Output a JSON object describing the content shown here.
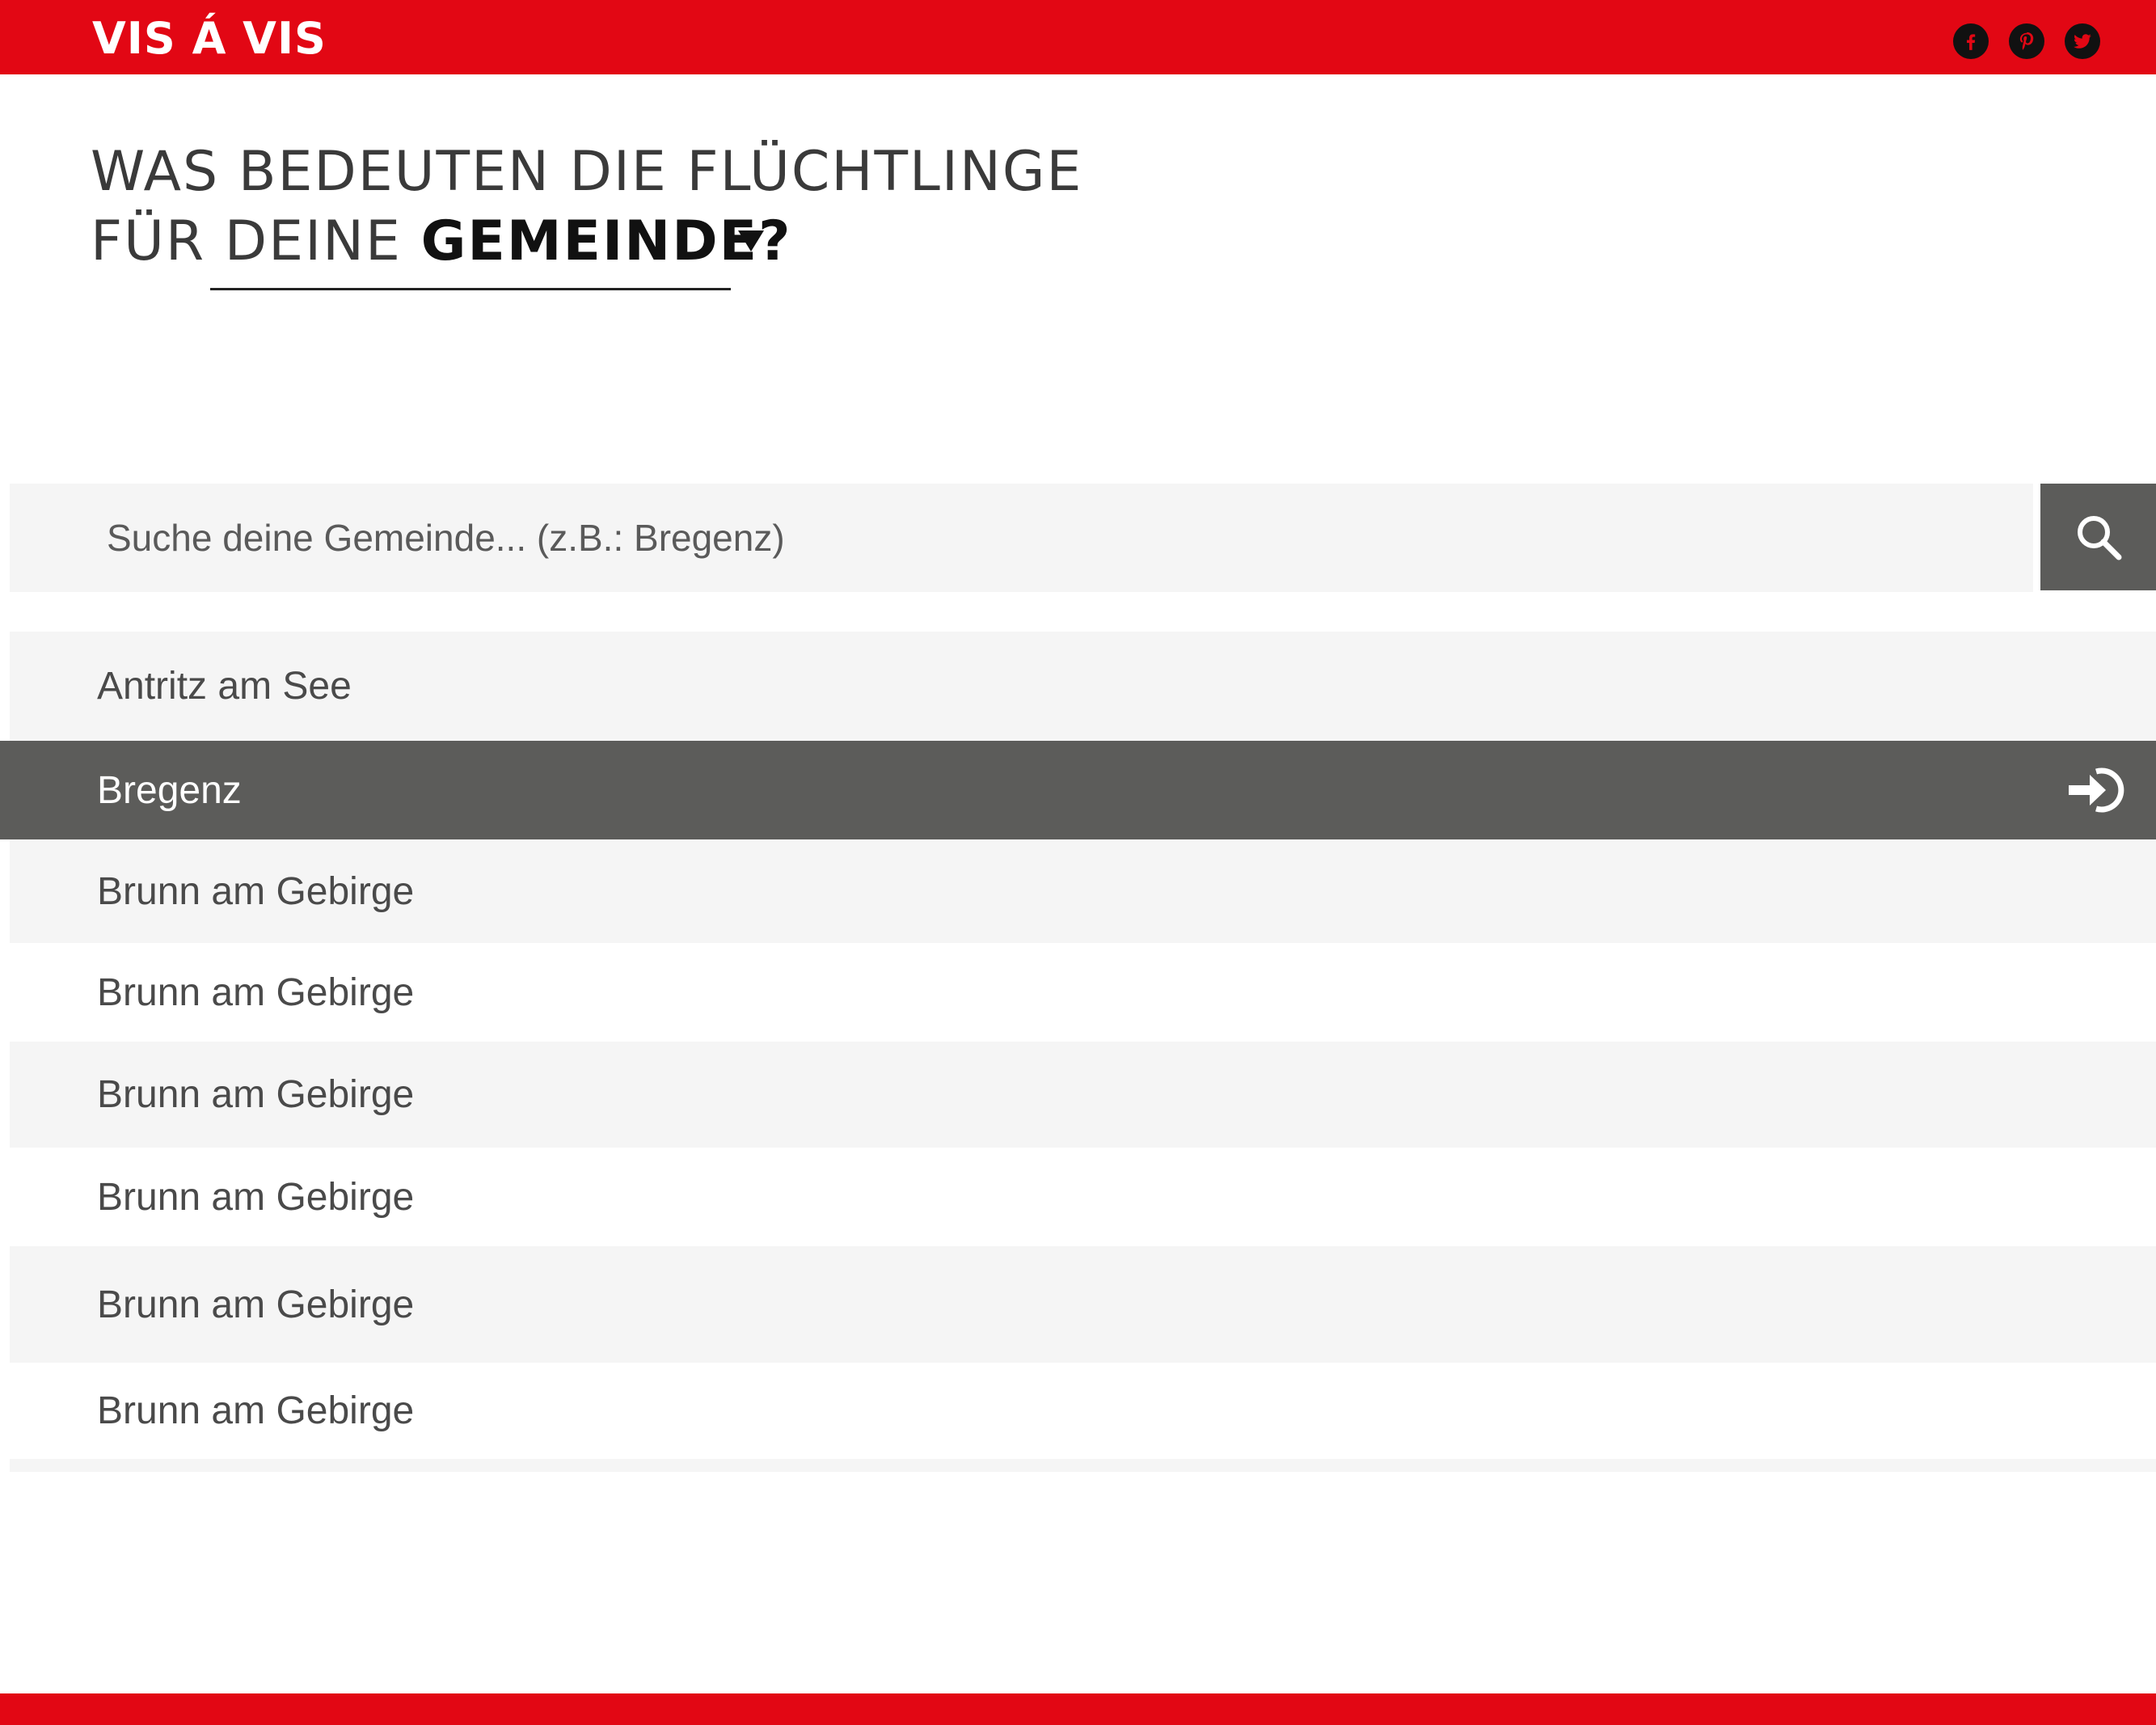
{
  "header": {
    "logo": "VIS Á VIS",
    "social": [
      {
        "icon": "facebook-icon",
        "glyph": "f"
      },
      {
        "icon": "pinterest-icon",
        "glyph": "p"
      },
      {
        "icon": "twitter-icon",
        "glyph": "t"
      }
    ]
  },
  "headline": {
    "line1": "WAS BEDEUTEN DIE FLÜCHTLINGE",
    "line2_prefix": "FÜR",
    "line2_select": "DEINE",
    "line2_bold": "GEMEINDE?"
  },
  "search": {
    "placeholder": "Suche deine Gemeinde... (z.B.: Bregenz)"
  },
  "results": [
    {
      "label": "Antritz am See"
    },
    {
      "label": "Bregenz"
    },
    {
      "label": "Brunn am Gebirge"
    },
    {
      "label": "Brunn am Gebirge"
    },
    {
      "label": "Brunn am Gebirge"
    },
    {
      "label": "Brunn am Gebirge"
    },
    {
      "label": "Brunn am Gebirge"
    },
    {
      "label": "Brunn am Gebirge"
    }
  ],
  "colors": {
    "brand_red": "#e20714",
    "selected_row": "#5c5c5a",
    "row_gray": "#f5f5f5"
  }
}
